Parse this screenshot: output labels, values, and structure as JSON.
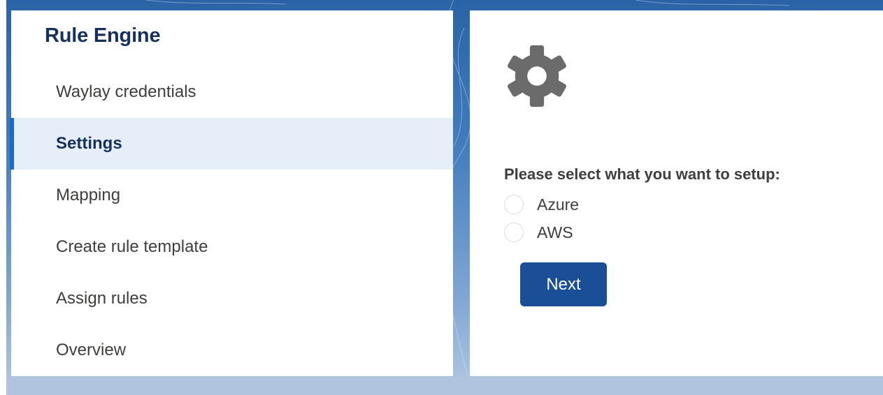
{
  "nav": {
    "title": "Rule Engine",
    "items": [
      {
        "label": "Waylay credentials",
        "active": false
      },
      {
        "label": "Settings",
        "active": true
      },
      {
        "label": "Mapping",
        "active": false
      },
      {
        "label": "Create rule template",
        "active": false
      },
      {
        "label": "Assign rules",
        "active": false
      },
      {
        "label": "Overview",
        "active": false
      }
    ]
  },
  "content": {
    "icon": "gear-icon",
    "prompt": "Please select what you want to setup:",
    "options": [
      {
        "label": "Azure",
        "selected": false
      },
      {
        "label": "AWS",
        "selected": false
      }
    ],
    "next_label": "Next"
  },
  "colors": {
    "brand": "#1a4f97",
    "active_indicator": "#1b6ac9",
    "active_bg": "#e6eef9",
    "icon": "#6b6b6b"
  }
}
